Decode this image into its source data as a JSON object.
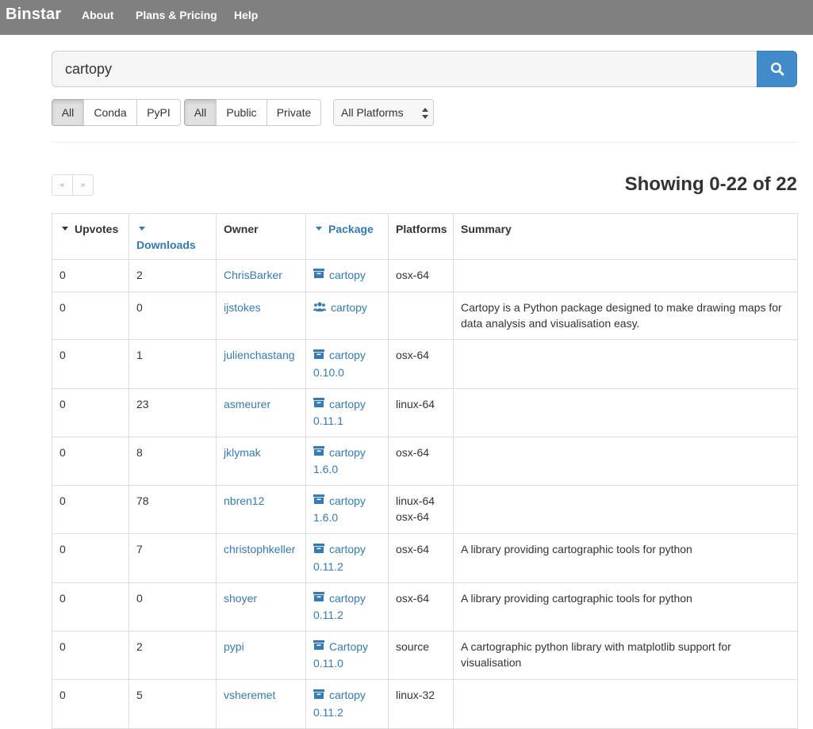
{
  "nav": {
    "brand": "Binstar",
    "links": [
      "About",
      "Plans & Pricing",
      "Help"
    ]
  },
  "search": {
    "value": "cartopy"
  },
  "filters": {
    "type": [
      {
        "label": "All",
        "active": true
      },
      {
        "label": "Conda",
        "active": false
      },
      {
        "label": "PyPI",
        "active": false
      }
    ],
    "access": [
      {
        "label": "All",
        "active": true
      },
      {
        "label": "Public",
        "active": false
      },
      {
        "label": "Private",
        "active": false
      }
    ],
    "platform": "All Platforms"
  },
  "pager": {
    "prev": "«",
    "next": "»"
  },
  "showing": "Showing 0-22 of 22",
  "table": {
    "headers": {
      "upvotes": "Upvotes",
      "downloads": "Downloads",
      "owner": "Owner",
      "package": "Package",
      "platforms": "Platforms",
      "summary": "Summary"
    },
    "rows": [
      {
        "upvotes": "0",
        "downloads": "2",
        "owner": "ChrisBarker",
        "package": "cartopy",
        "version": "",
        "icon": "package-icon",
        "platforms": [
          "osx-64"
        ],
        "summary": ""
      },
      {
        "upvotes": "0",
        "downloads": "0",
        "owner": "ijstokes",
        "package": "cartopy",
        "version": "",
        "icon": "group-icon",
        "platforms": [],
        "summary": "Cartopy is a Python package designed to make drawing maps for data analysis and visualisation easy."
      },
      {
        "upvotes": "0",
        "downloads": "1",
        "owner": "julienchastang",
        "package": "cartopy",
        "version": "0.10.0",
        "icon": "package-icon",
        "platforms": [
          "osx-64"
        ],
        "summary": ""
      },
      {
        "upvotes": "0",
        "downloads": "23",
        "owner": "asmeurer",
        "package": "cartopy",
        "version": "0.11.1",
        "icon": "package-icon",
        "platforms": [
          "linux-64"
        ],
        "summary": ""
      },
      {
        "upvotes": "0",
        "downloads": "8",
        "owner": "jklymak",
        "package": "cartopy",
        "version": "1.6.0",
        "icon": "package-icon",
        "platforms": [
          "osx-64"
        ],
        "summary": ""
      },
      {
        "upvotes": "0",
        "downloads": "78",
        "owner": "nbren12",
        "package": "cartopy",
        "version": "1.6.0",
        "icon": "package-icon",
        "platforms": [
          "linux-64",
          "osx-64"
        ],
        "summary": ""
      },
      {
        "upvotes": "0",
        "downloads": "7",
        "owner": "christophkeller",
        "package": "cartopy",
        "version": "0.11.2",
        "icon": "package-icon",
        "platforms": [
          "osx-64"
        ],
        "summary": "A library providing cartographic tools for python"
      },
      {
        "upvotes": "0",
        "downloads": "0",
        "owner": "shoyer",
        "package": "cartopy",
        "version": "0.11.2",
        "icon": "package-icon",
        "platforms": [
          "osx-64"
        ],
        "summary": "A library providing cartographic tools for python"
      },
      {
        "upvotes": "0",
        "downloads": "2",
        "owner": "pypi",
        "package": "Cartopy",
        "version": "0.11.0",
        "icon": "package-icon",
        "platforms": [
          "source"
        ],
        "summary": "A cartographic python library with matplotlib support for visualisation"
      },
      {
        "upvotes": "0",
        "downloads": "5",
        "owner": "vsheremet",
        "package": "cartopy",
        "version": "0.11.2",
        "icon": "package-icon",
        "platforms": [
          "linux-32"
        ],
        "summary": ""
      }
    ]
  }
}
